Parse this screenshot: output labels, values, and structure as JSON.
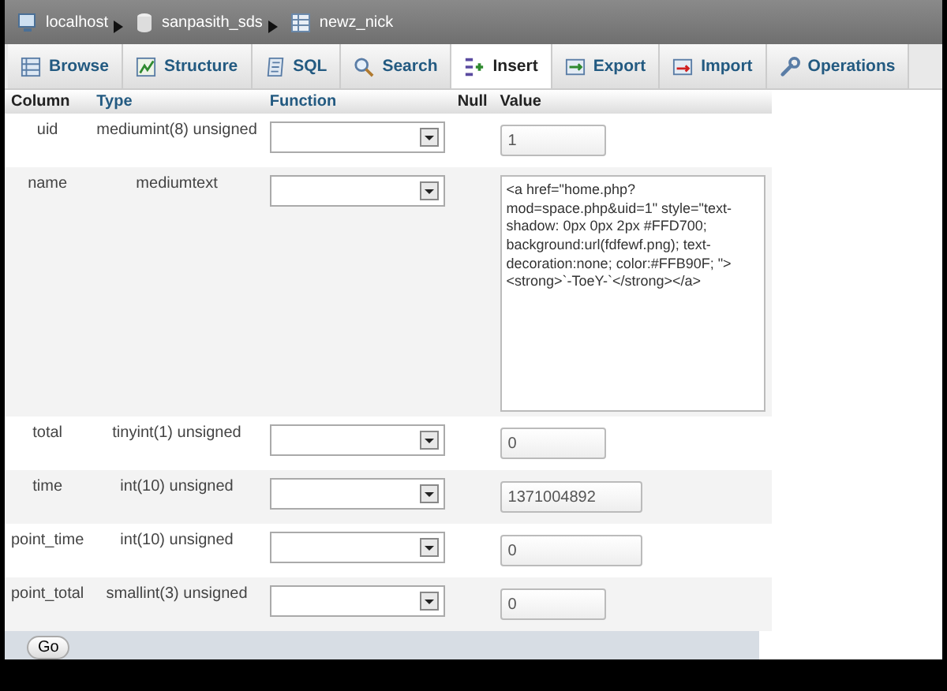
{
  "breadcrumb": [
    {
      "kind": "server",
      "label": "localhost"
    },
    {
      "kind": "database",
      "label": "sanpasith_sds"
    },
    {
      "kind": "table",
      "label": "newz_nick"
    }
  ],
  "tabs": [
    {
      "kind": "browse",
      "label": "Browse",
      "selected": false
    },
    {
      "kind": "structure",
      "label": "Structure",
      "selected": false
    },
    {
      "kind": "sql",
      "label": "SQL",
      "selected": false
    },
    {
      "kind": "search",
      "label": "Search",
      "selected": false
    },
    {
      "kind": "insert",
      "label": "Insert",
      "selected": true
    },
    {
      "kind": "export",
      "label": "Export",
      "selected": false
    },
    {
      "kind": "import",
      "label": "Import",
      "selected": false
    },
    {
      "kind": "operations",
      "label": "Operations",
      "selected": false
    }
  ],
  "table": {
    "columns": [
      "Column",
      "Type",
      "Function",
      "Null",
      "Value"
    ],
    "rows": [
      {
        "column": "uid",
        "type": "mediumint(8) unsigned",
        "kind": "input",
        "wide": false,
        "value": "1"
      },
      {
        "column": "name",
        "type": "mediumtext",
        "kind": "textarea",
        "value": "<a href=\"home.php?mod=space.php&uid=1\" style=\"text-shadow: 0px 0px 2px #FFD700; background:url(fdfewf.png); text-decoration:none; color:#FFB90F; \"><strong>`-ToeY-`</strong></a>"
      },
      {
        "column": "total",
        "type": "tinyint(1) unsigned",
        "kind": "input",
        "wide": false,
        "value": "0"
      },
      {
        "column": "time",
        "type": "int(10) unsigned",
        "kind": "input",
        "wide": true,
        "value": "1371004892"
      },
      {
        "column": "point_time",
        "type": "int(10) unsigned",
        "kind": "input",
        "wide": true,
        "value": "0"
      },
      {
        "column": "point_total",
        "type": "smallint(3) unsigned",
        "kind": "input",
        "wide": false,
        "value": "0"
      }
    ]
  },
  "go_button": "Go"
}
